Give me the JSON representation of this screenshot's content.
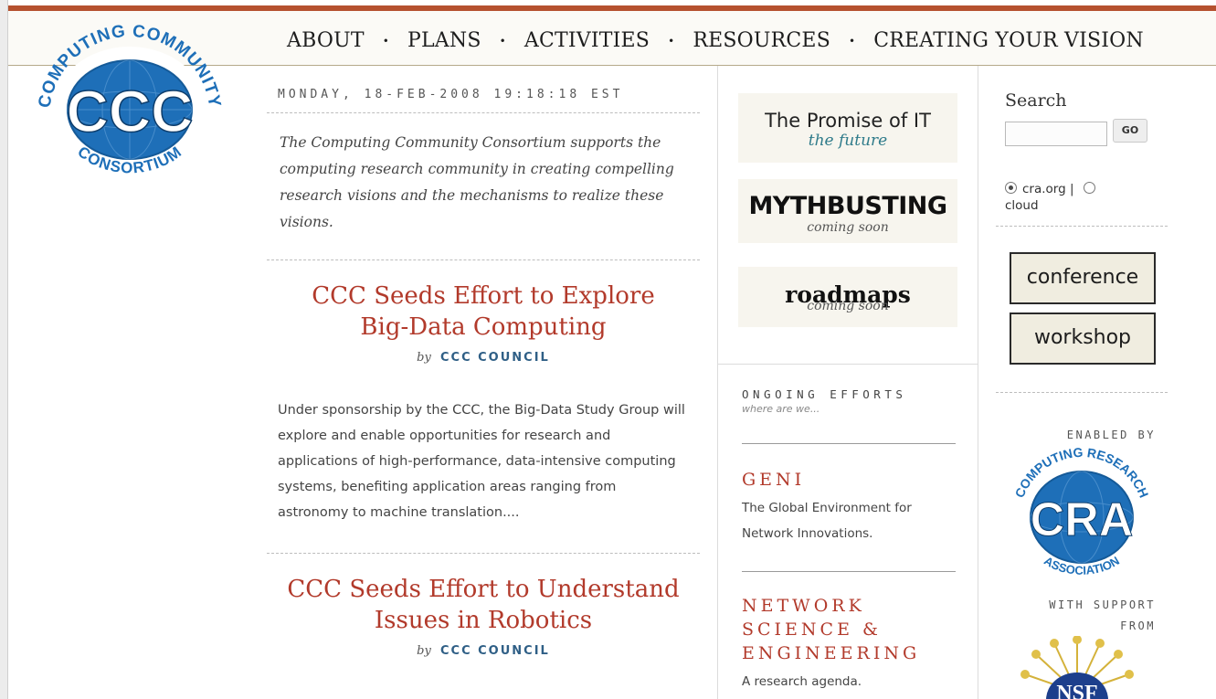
{
  "logo": {
    "top_text": "COMPUTING COMMUNITY",
    "center_text": "CCC",
    "bottom_text": "CONSORTIUM",
    "color": "#1e6fb8"
  },
  "nav": {
    "items": [
      "ABOUT",
      "PLANS",
      "ACTIVITIES",
      "RESOURCES",
      "CREATING YOUR VISION"
    ],
    "separator": "•"
  },
  "main": {
    "date": "MONDAY, 18-FEB-2008 19:18:18 EST",
    "intro": "The Computing Community Consortium supports the computing research community in creating compelling research visions and the mechanisms to realize these visions.",
    "articles": [
      {
        "title_line1": "CCC Seeds Effort to Explore",
        "title_line2": "Big-Data Computing",
        "by": "by",
        "author": "CCC COUNCIL",
        "summary": "Under sponsorship by the CCC, the Big-Data Study Group will explore and enable opportunities for research and applications of high-performance, data-intensive computing systems, benefiting application areas ranging from astronomy to machine translation...."
      },
      {
        "title_line1": "CCC Seeds Effort to Understand",
        "title_line2": "Issues in Robotics",
        "by": "by",
        "author": "CCC COUNCIL"
      }
    ]
  },
  "promos": {
    "promise_title": "The Promise of IT",
    "promise_sub": "the future",
    "mythbusting_title": "MYTHBUSTING",
    "mythbusting_sub": "coming soon",
    "roadmaps_title": "roadmaps",
    "roadmaps_sub": "coming soon"
  },
  "ongoing": {
    "heading": "ONGOING EFFORTS",
    "subheading": "where are we...",
    "efforts": [
      {
        "title": "GENI",
        "desc": "The Global Environment for Network Innovations."
      },
      {
        "title_lines": [
          "NETWORK",
          "SCIENCE &",
          "ENGINEERING"
        ],
        "desc": "A research agenda."
      }
    ]
  },
  "search": {
    "label": "Search",
    "value": "",
    "go_label": "GO",
    "option_1": "cra.org |",
    "option_2": "cloud",
    "selected": "cra.org"
  },
  "buttons": {
    "conference": "conference",
    "workshop": "workshop"
  },
  "sponsors": {
    "enabled_by": "ENABLED BY",
    "cra_top_text": "COMPUTING RESEARCH",
    "cra_center_text": "CRA",
    "cra_bottom_text": "ASSOCIATION",
    "support_line1": "WITH SUPPORT",
    "support_line2": "FROM",
    "nsf_text": "NSF"
  },
  "colors": {
    "accent_red": "#b23a2b",
    "byline_blue": "#2f5f86",
    "top_stripe": "#b5512f",
    "logo_blue": "#1e6fb8"
  }
}
